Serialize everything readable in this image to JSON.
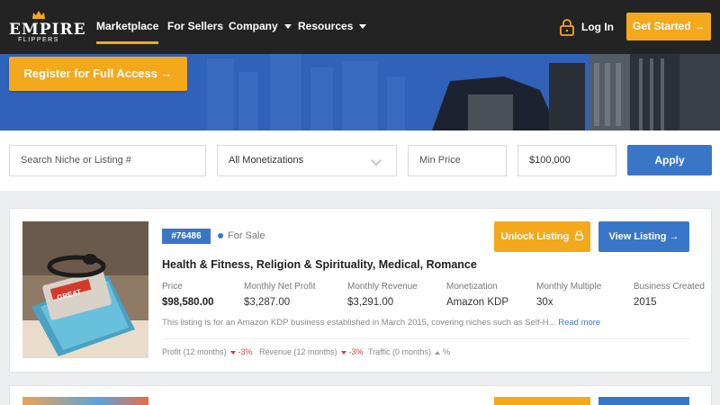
{
  "brand": {
    "logo_word": "EMPIRE",
    "logo_sub": "FLIPPERS",
    "accent": "#f4a81c",
    "primary": "#3a76c8",
    "nav_bg": "#232323"
  },
  "nav": {
    "links": [
      {
        "label": "Marketplace",
        "active": true
      },
      {
        "label": "For Sellers"
      },
      {
        "label": "Company",
        "dropdown": true
      },
      {
        "label": "Resources",
        "dropdown": true
      }
    ],
    "login_label": "Log In",
    "login_icon": "lock-icon",
    "cta_label": "Get Started →"
  },
  "hero": {
    "register_label": "Register for Full Access →"
  },
  "filters": {
    "search_placeholder": "Search Niche or Listing #",
    "monetization_value": "All Monetizations",
    "min_price_placeholder": "Min Price",
    "max_price_value": "$100,000",
    "apply_label": "Apply"
  },
  "listing": {
    "id": "#76486",
    "status": "For Sale",
    "unlock_label": "Unlock Listing",
    "view_label": "View Listing →",
    "title": "Health & Fitness, Religion & Spirituality, Medical, Romance",
    "stats": [
      {
        "label": "Price",
        "value": "$98,580.00"
      },
      {
        "label": "Monthly Net Profit",
        "value": "$3,287.00"
      },
      {
        "label": "Monthly Revenue",
        "value": "$3,291.00"
      },
      {
        "label": "Monetization",
        "value": "Amazon KDP"
      },
      {
        "label": "Monthly Multiple",
        "value": "30x"
      },
      {
        "label": "Business Created",
        "value": "2015"
      }
    ],
    "description": "This listing is for an Amazon KDP business established in March 2015, covering niches such as Self-H...",
    "read_more": "Read more",
    "metrics": [
      {
        "label": "Profit (12 months)",
        "value": "-3%",
        "trend": "down"
      },
      {
        "label": "Revenue (12 months)",
        "value": "-3%",
        "trend": "down"
      },
      {
        "label": "Traffic (0 months)",
        "value": "%",
        "trend": "up"
      }
    ],
    "thumb_text": "GREAT"
  }
}
